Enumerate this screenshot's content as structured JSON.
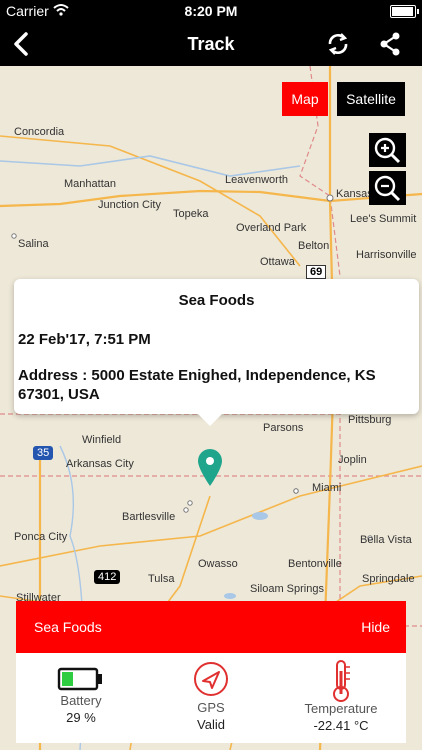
{
  "status_bar": {
    "carrier": "Carrier",
    "time": "8:20 PM"
  },
  "nav": {
    "title": "Track"
  },
  "map_controls": {
    "map_label": "Map",
    "satellite_label": "Satellite"
  },
  "map_labels": [
    "Concordia",
    "Manhattan",
    "Junction City",
    "Leavenworth",
    "Kansas",
    "Lee's Summit",
    "Topeka",
    "Overland Park",
    "Salina",
    "Harrisonville",
    "Belton",
    "Ottawa",
    "Pittsburg",
    "Parsons",
    "Winfield",
    "Arkansas City",
    "Joplin",
    "Miami",
    "Ponca City",
    "Bartlesville",
    "Bella Vista",
    "Bentonville",
    "Owasso",
    "Tulsa",
    "Springdale",
    "Siloam Springs",
    "Stillwater",
    "35",
    "69",
    "412"
  ],
  "popup": {
    "title": "Sea Foods",
    "date": "22 Feb'17, 7:51 PM",
    "address": "Address : 5000 Estate Enighed, Independence, KS 67301, USA"
  },
  "bottom_bar": {
    "title": "Sea Foods",
    "hide_label": "Hide"
  },
  "stats": {
    "battery": {
      "label": "Battery",
      "value": "29 %"
    },
    "gps": {
      "label": "GPS",
      "value": "Valid"
    },
    "temperature": {
      "label": "Temperature",
      "value": "-22.41 °C"
    }
  },
  "colors": {
    "accent": "#ff0000",
    "nav_bg": "#000000",
    "pin": "#1fa58c",
    "battery": "#2ecc40"
  }
}
